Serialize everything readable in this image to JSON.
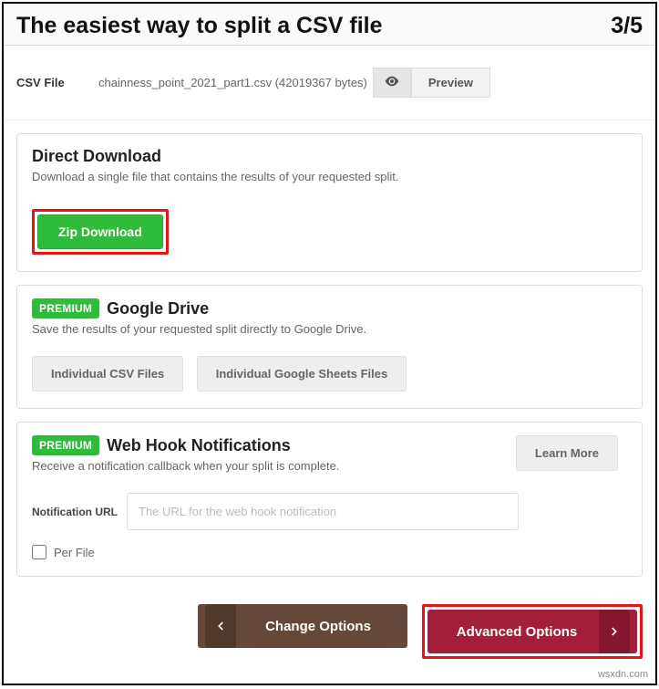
{
  "header": {
    "title": "The easiest way to split a CSV file",
    "step": "3/5"
  },
  "file": {
    "label": "CSV File",
    "name": "chainness_point_2021_part1.csv (42019367 bytes)",
    "preview": "Preview"
  },
  "direct": {
    "title": "Direct Download",
    "sub": "Download a single file that contains the results of your requested split.",
    "zip": "Zip Download"
  },
  "drive": {
    "badge": "PREMIUM",
    "title": "Google Drive",
    "sub": "Save the results of your requested split directly to Google Drive.",
    "btn1": "Individual CSV Files",
    "btn2": "Individual Google Sheets Files"
  },
  "webhook": {
    "badge": "PREMIUM",
    "title": "Web Hook Notifications",
    "sub": "Receive a notification callback when your split is complete.",
    "learn": "Learn More",
    "url_label": "Notification URL",
    "url_placeholder": "The URL for the web hook notification",
    "perfile": "Per File"
  },
  "footer": {
    "change": "Change Options",
    "advanced": "Advanced Options"
  },
  "watermark": "wsxdn.com"
}
